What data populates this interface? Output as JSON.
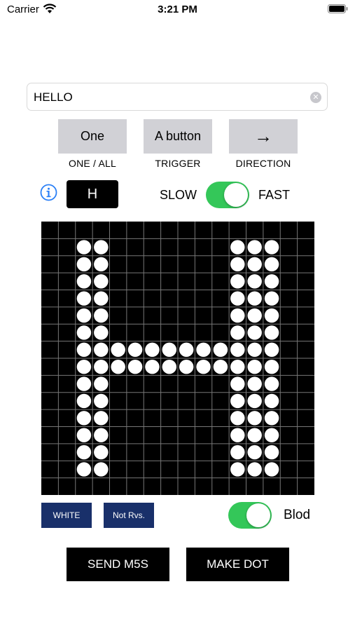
{
  "status_bar": {
    "carrier": "Carrier",
    "time": "3:21 PM"
  },
  "text_field": {
    "value": "HELLO"
  },
  "mode_buttons": [
    {
      "label": "One",
      "caption": "ONE / ALL"
    },
    {
      "label": "A button",
      "caption": "TRIGGER"
    },
    {
      "label": "→",
      "caption": "DIRECTION"
    }
  ],
  "current_char": "H",
  "speed": {
    "slow_label": "SLOW",
    "fast_label": "FAST",
    "is_fast": true
  },
  "matrix": {
    "cols": 16,
    "rows": 16,
    "on_dots": [
      [
        1,
        2
      ],
      [
        1,
        3
      ],
      [
        1,
        11
      ],
      [
        1,
        12
      ],
      [
        1,
        13
      ],
      [
        2,
        2
      ],
      [
        2,
        3
      ],
      [
        2,
        11
      ],
      [
        2,
        12
      ],
      [
        2,
        13
      ],
      [
        3,
        2
      ],
      [
        3,
        3
      ],
      [
        3,
        11
      ],
      [
        3,
        12
      ],
      [
        3,
        13
      ],
      [
        4,
        2
      ],
      [
        4,
        3
      ],
      [
        4,
        11
      ],
      [
        4,
        12
      ],
      [
        4,
        13
      ],
      [
        5,
        2
      ],
      [
        5,
        3
      ],
      [
        5,
        11
      ],
      [
        5,
        12
      ],
      [
        5,
        13
      ],
      [
        6,
        2
      ],
      [
        6,
        3
      ],
      [
        6,
        11
      ],
      [
        6,
        12
      ],
      [
        6,
        13
      ],
      [
        7,
        2
      ],
      [
        7,
        3
      ],
      [
        7,
        4
      ],
      [
        7,
        5
      ],
      [
        7,
        6
      ],
      [
        7,
        7
      ],
      [
        7,
        8
      ],
      [
        7,
        9
      ],
      [
        7,
        10
      ],
      [
        7,
        11
      ],
      [
        7,
        12
      ],
      [
        7,
        13
      ],
      [
        8,
        2
      ],
      [
        8,
        3
      ],
      [
        8,
        4
      ],
      [
        8,
        5
      ],
      [
        8,
        6
      ],
      [
        8,
        7
      ],
      [
        8,
        8
      ],
      [
        8,
        9
      ],
      [
        8,
        10
      ],
      [
        8,
        11
      ],
      [
        8,
        12
      ],
      [
        8,
        13
      ],
      [
        9,
        2
      ],
      [
        9,
        3
      ],
      [
        9,
        11
      ],
      [
        9,
        12
      ],
      [
        9,
        13
      ],
      [
        10,
        2
      ],
      [
        10,
        3
      ],
      [
        10,
        11
      ],
      [
        10,
        12
      ],
      [
        10,
        13
      ],
      [
        11,
        2
      ],
      [
        11,
        3
      ],
      [
        11,
        11
      ],
      [
        11,
        12
      ],
      [
        11,
        13
      ],
      [
        12,
        2
      ],
      [
        12,
        3
      ],
      [
        12,
        11
      ],
      [
        12,
        12
      ],
      [
        12,
        13
      ],
      [
        13,
        2
      ],
      [
        13,
        3
      ],
      [
        13,
        11
      ],
      [
        13,
        12
      ],
      [
        13,
        13
      ],
      [
        14,
        2
      ],
      [
        14,
        3
      ],
      [
        14,
        11
      ],
      [
        14,
        12
      ],
      [
        14,
        13
      ]
    ],
    "dot_color": "#ffffff",
    "background_color": "#000000",
    "grid_color": "#777777"
  },
  "color_button": "WHITE",
  "reverse_button": "Not Rvs.",
  "bold": {
    "label": "Blod",
    "on": true
  },
  "send_button": "SEND M5S",
  "make_dot_button": "MAKE DOT",
  "colors": {
    "accent_green": "#34c759",
    "navy": "#19306a",
    "info_blue": "#2a7ff6"
  },
  "icons": {
    "info": "info-circle-icon",
    "clear": "clear-icon",
    "wifi": "wifi-icon",
    "battery": "battery-icon",
    "arrow": "arrow-right-icon"
  }
}
